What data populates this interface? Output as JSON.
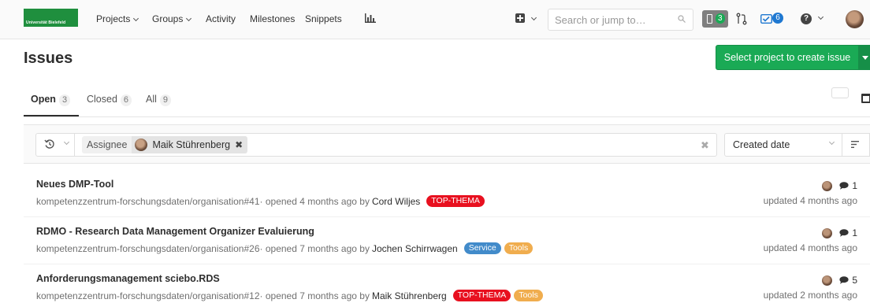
{
  "nav": {
    "logo_text": "Universität Bielefeld",
    "items": [
      {
        "label": "Projects",
        "has_caret": true
      },
      {
        "label": "Groups",
        "has_caret": true
      },
      {
        "label": "Activity",
        "has_caret": false
      },
      {
        "label": "Milestones",
        "has_caret": false
      },
      {
        "label": "Snippets",
        "has_caret": false
      }
    ],
    "chart_icon": "chart-icon",
    "new_icon": "plus-square-icon",
    "search_placeholder": "Search or jump to…",
    "todo_count": "3",
    "merge_request_icon": "merge-request-icon",
    "todos_count": "6",
    "help_icon_glyph": "?",
    "accent_green": "#1aaa55",
    "accent_blue": "#1f78d1"
  },
  "page": {
    "title": "Issues",
    "new_issue_button": "Select project to create issue"
  },
  "tabs": [
    {
      "label": "Open",
      "count": "3",
      "active": true
    },
    {
      "label": "Closed",
      "count": "6",
      "active": false
    },
    {
      "label": "All",
      "count": "9",
      "active": false
    }
  ],
  "filter": {
    "token_name": "Assignee",
    "token_value": "Maik Stührenberg",
    "token_remove": "✖",
    "clear": "✖",
    "sort_label": "Created date"
  },
  "issues": [
    {
      "title": "Neues DMP-Tool",
      "ref": "kompetenzzentrum-forschungsdaten/organisation#41",
      "opened": " · opened 4 months ago by",
      "author": "Cord Wiljes",
      "labels": [
        {
          "text": "TOP-THEMA",
          "color": "#e8101f"
        }
      ],
      "comments": "1",
      "updated": "updated 4 months ago"
    },
    {
      "title": "RDMO - Research Data Management Organizer Evaluierung",
      "ref": "kompetenzzentrum-forschungsdaten/organisation#26",
      "opened": " · opened 7 months ago by",
      "author": "Jochen Schirrwagen",
      "labels": [
        {
          "text": "Service",
          "color": "#428bca"
        },
        {
          "text": "Tools",
          "color": "#f0ad4e"
        }
      ],
      "comments": "1",
      "updated": "updated 4 months ago"
    },
    {
      "title": "Anforderungsmanagement sciebo.RDS",
      "ref": "kompetenzzentrum-forschungsdaten/organisation#12",
      "opened": " · opened 7 months ago by",
      "author": "Maik Stührenberg",
      "labels": [
        {
          "text": "TOP-THEMA",
          "color": "#e8101f"
        },
        {
          "text": "Tools",
          "color": "#f0ad4e"
        }
      ],
      "comments": "5",
      "updated": "updated 2 months ago"
    }
  ]
}
